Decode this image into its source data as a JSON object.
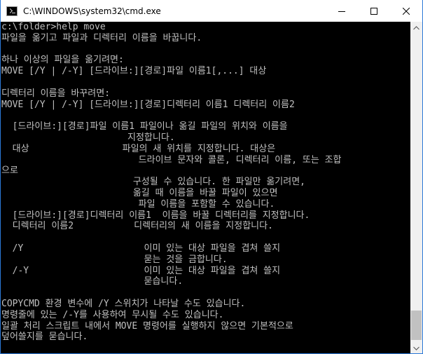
{
  "window": {
    "title": "C:\\WINDOWS\\system32\\cmd.exe",
    "icon": "console-icon",
    "controls": [
      "minimize-icon",
      "maximize-icon",
      "close-icon"
    ]
  },
  "console": {
    "lines": [
      "c:\\folder>help move",
      "파일을 옮기고 파일과 디렉터리 이름을 바꿉니다.",
      "",
      "하나 이상의 파일을 옮기려면:",
      "MOVE [/Y | /-Y] [드라이브:][경로]파일 이름1[,...] 대상",
      "",
      "디렉터리 이름을 바꾸려면:",
      "MOVE [/Y | /-Y] [드라이브:][경로]디렉터리 이름1 디렉터리 이름2",
      "",
      "  [드라이브:][경로]파일 이름1 파일이나 옮길 파일의 위치와 이름을",
      "                       지정합니다.",
      "  대상                 파일의 새 위치를 지정합니다. 대상은",
      "                         드라이브 문자와 콜론, 디렉터리 이름, 또는 조합",
      "으로",
      "                        구성될 수 있습니다. 한 파일만 옮기려면,",
      "                        옮길 때 이름을 바꿀 파일이 있으면",
      "                         파일 이름을 포함할 수 있습니다.",
      "  [드라이브:][경로]디렉터리 이름1  이름을 바꿀 디렉터리를 지정합니다.",
      "  디렉터리 이름2           디렉터리의 새 이름을 지정합니다.",
      "",
      "  /Y                      이미 있는 대상 파일을 겹쳐 쓸지",
      "                          묻는 것을 금합니다.",
      "  /-Y                     이미 있는 대상 파일을 겹쳐 쓸지",
      "                          묻습니다.",
      "",
      "COPYCMD 환경 변수에 /Y 스위치가 나타날 수도 있습니다.",
      "명령줄에 있는 /-Y를 사용하여 무시될 수도 있습니다.",
      "일괄 처리 스크립트 내에서 MOVE 명령어를 실행하지 않으면 기본적으로",
      "덮어쓸지를 묻습니다.",
      ""
    ]
  }
}
